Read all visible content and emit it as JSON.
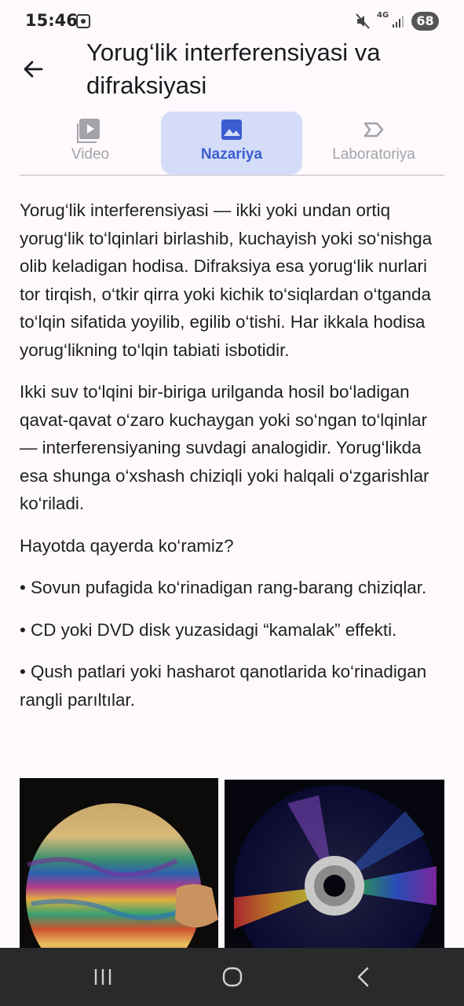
{
  "status_bar": {
    "time": "15:46",
    "network": "4G",
    "battery": "68"
  },
  "header": {
    "title": "Yorug‘lik interferensiyasi va difraksiyasi"
  },
  "tabs": [
    {
      "label": "Video",
      "icon": "video-library-icon",
      "selected": false
    },
    {
      "label": "Nazariya",
      "icon": "image-icon",
      "selected": true
    },
    {
      "label": "Laboratoriya",
      "icon": "label-tag-icon",
      "selected": false
    }
  ],
  "content": {
    "paragraphs": [
      "Yorug‘lik interferensiyasi — ikki yoki undan ortiq yorug‘lik to‘lqinlari birlashib, kuchayish yoki so‘nishga olib keladigan hodisa. Difraksiya esa yorug‘lik nurlari tor tirqish, o‘tkir qirra yoki kichik to‘siqlardan o‘tganda to‘lqin sifatida yoyilib, egilib o‘tishi. Har ikkala hodisa yorug‘likning to‘lqin tabiati isbotidir.",
      "Ikki suv to‘lqini bir-biriga urilganda hosil bo‘ladigan qavat-qavat o‘zaro kuchaygan yoki so‘ngan to‘lqinlar — interferensiyaning suvdagi analogidir. Yorug‘likda esa shunga o‘xshash chiziqli yoki halqali o‘zgarishlar ko‘riladi.",
      "Hayotda qayerda ko‘ramiz?",
      "• Sovun pufagida ko‘rinadigan rang-barang chiziqlar.",
      "• CD yoki DVD disk yuzasidagi “kamalak” effekti.",
      "• Qush patlari yoki hasharot qanotlarida ko‘rinadigan rangli parıltılar."
    ]
  },
  "colors": {
    "accent": "#3a5ed0",
    "selected_tab_bg": "#d4dcf8",
    "inactive_tab": "#a3a3a8",
    "nav_bar": "#2a2a2c"
  }
}
